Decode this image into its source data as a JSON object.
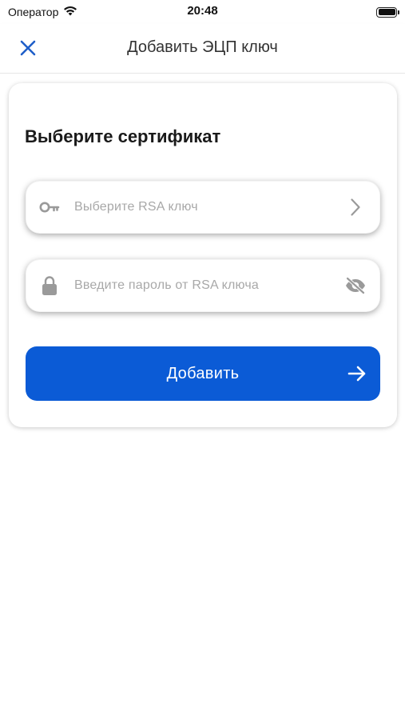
{
  "status_bar": {
    "carrier": "Оператор",
    "time": "20:48"
  },
  "nav": {
    "title": "Добавить ЭЦП ключ",
    "close_icon": "close-icon"
  },
  "card": {
    "title": "Выберите сертификат",
    "rsa_field": {
      "placeholder": "Выберите RSA ключ",
      "leading_icon": "key-icon",
      "trailing_icon": "chevron-right-icon"
    },
    "password_field": {
      "placeholder": "Введите пароль от RSA ключа",
      "leading_icon": "lock-icon",
      "trailing_icon": "eye-off-icon"
    },
    "submit_button": {
      "label": "Добавить",
      "icon": "arrow-right-icon"
    }
  },
  "colors": {
    "accent": "#0b5bd6",
    "close_icon": "#1f5fc9",
    "placeholder": "#a8a8a8",
    "icon_gray": "#9a9a9a"
  }
}
